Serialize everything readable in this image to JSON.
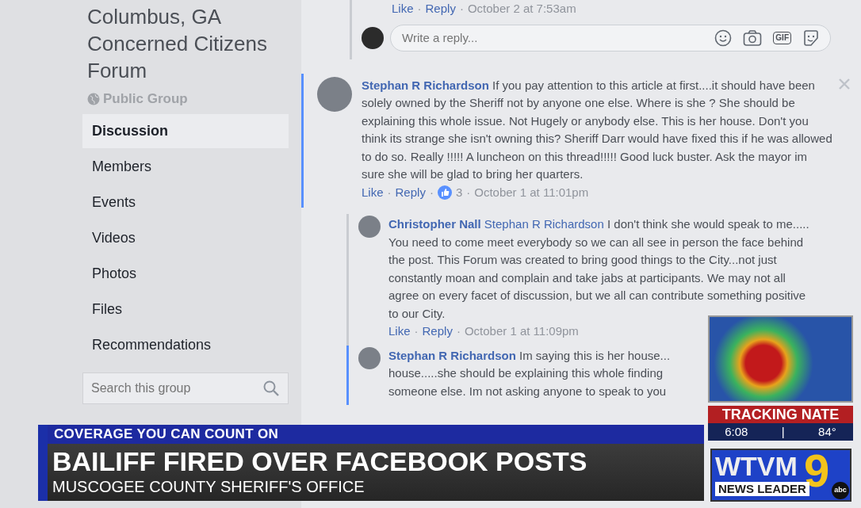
{
  "group": {
    "title": "Columbus, GA Concerned Citizens Forum",
    "privacy": "Public Group"
  },
  "nav": [
    {
      "label": "Discussion",
      "selected": true
    },
    {
      "label": "Members",
      "selected": false
    },
    {
      "label": "Events",
      "selected": false
    },
    {
      "label": "Videos",
      "selected": false
    },
    {
      "label": "Photos",
      "selected": false
    },
    {
      "label": "Files",
      "selected": false
    },
    {
      "label": "Recommendations",
      "selected": false
    }
  ],
  "search": {
    "placeholder": "Search this group"
  },
  "previous_actions": {
    "like": "Like",
    "separator": "·",
    "reply": "Reply",
    "time": "October 2 at 7:53am"
  },
  "reply_box": {
    "placeholder": "Write a reply...",
    "gif_label": "GIF"
  },
  "comments": [
    {
      "author": "Stephan R Richardson",
      "text": "If you pay attention to this article at first....it should have been solely owned by the Sheriff not by anyone one else. Where is she ? She should be explaining this whole issue. Not Hugely or anybody else. This is her house. Don't you think its strange she isn't owning this? Sheriff Darr would have fixed this if he was allowed to do so. Really !!!!! A luncheon on this thread!!!!! Good luck buster. Ask the mayor im sure she will be glad to bring her quarters.",
      "like": "Like",
      "separator": "·",
      "reply": "Reply",
      "reactions": "3",
      "time": "October 1 at 11:01pm",
      "replies": [
        {
          "author": "Christopher Nall",
          "mention": "Stephan R Richardson",
          "text": "I don't think she would speak to me..... You need to come meet everybody so we can all see in person the face behind the post. This Forum was created to bring good things to the City...not just constantly moan and complain and take jabs at participants. We may not all agree on every facet of discussion, but we all can contribute something positive to our City.",
          "like": "Like",
          "separator": "·",
          "reply": "Reply",
          "time": "October 1 at 11:09pm"
        },
        {
          "author": "Stephan R Richardson",
          "text": "Im saying this is her house... house.....she should be explaining this whole finding someone else. Im not asking anyone to speak to you"
        }
      ]
    }
  ],
  "broadcast": {
    "kicker": "COVERAGE YOU CAN COUNT ON",
    "headline": "BAILIFF FIRED OVER FACEBOOK POSTS",
    "subhead": "MUSCOGEE COUNTY SHERIFF'S OFFICE",
    "weather": {
      "label": "TRACKING NATE",
      "time": "6:08",
      "separator": "|",
      "temperature": "84°"
    },
    "logo": {
      "callsign": "WTVM",
      "channel": "9",
      "tagline": "NEWS LEADER",
      "network": "abc"
    }
  }
}
